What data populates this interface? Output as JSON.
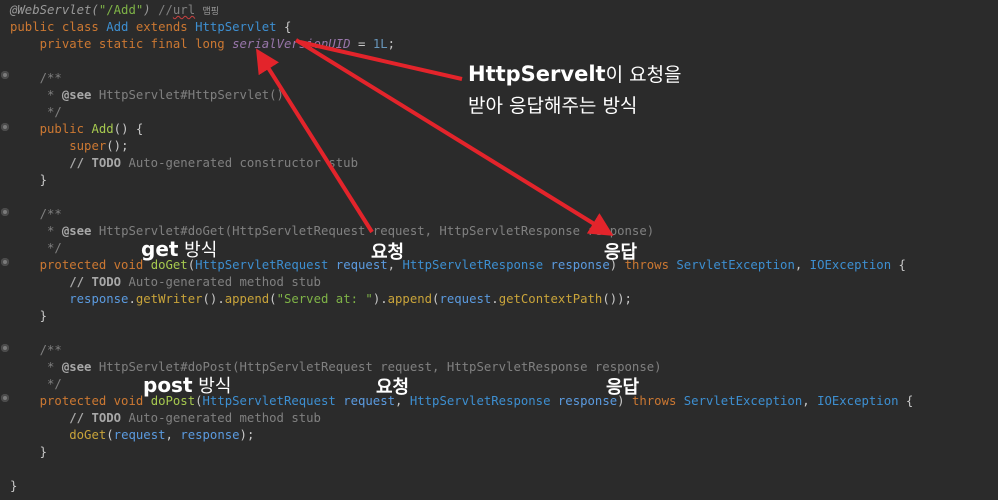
{
  "code": {
    "l1_ann": "@WebServlet(",
    "l1_str": "\"/Add\"",
    "l1_close": ")",
    "l1_cm": " //",
    "l1_url": "url",
    "l1_map": "맵핑",
    "l2_kw": "public class",
    "l2_cls": "Add",
    "l2_ext": "extends",
    "l2_sup": "HttpServlet",
    "l2_brace": " {",
    "l3_kw": "private static final long",
    "l3_fld": "serialVersionUID",
    "l3_eq": " = ",
    "l3_num": "1L",
    "l3_semi": ";",
    "l5": "/**",
    "l6_star": " * ",
    "l6_tag": "@see",
    "l6_rest": " HttpServlet#HttpServlet()",
    "l7": " */",
    "l8_kw": "public",
    "l8_name": "Add",
    "l8_rest": "() {",
    "l9_super": "super",
    "l9_rest": "();",
    "l10_todo": "// TODO",
    "l10_rest": " Auto-generated constructor stub",
    "l11": "}",
    "l13": "/**",
    "l14_star": " * ",
    "l14_tag": "@see",
    "l14_rest": " HttpServlet#doGet(HttpServletRequest request, HttpServletResponse response)",
    "l15": " */",
    "l16_kw": "protected void",
    "l16_name": "doGet",
    "l16_p1": "(",
    "l16_t1": "HttpServletRequest",
    "l16_v1": "request",
    "l16_c": ", ",
    "l16_t2": "HttpServletResponse",
    "l16_v2": "response",
    "l16_p2": ")",
    "l16_throws": "throws",
    "l16_e1": "ServletException",
    "l16_e2": "IOException",
    "l16_b": " {",
    "l17_todo": "// TODO",
    "l17_rest": " Auto-generated method stub",
    "l18_resp": "response",
    "l18_dot": ".",
    "l18_gw": "getWriter",
    "l18_a": "().",
    "l18_app": "append",
    "l18_p": "(",
    "l18_str": "\"Served at: \"",
    "l18_b": ").",
    "l18_app2": "append",
    "l18_p2": "(",
    "l18_req": "request",
    "l18_d2": ".",
    "l18_gcp": "getContextPath",
    "l18_end": "());",
    "l19": "}",
    "l21": "/**",
    "l22_star": " * ",
    "l22_tag": "@see",
    "l22_rest": " HttpServlet#doPost(HttpServletRequest request, HttpServletResponse response)",
    "l23": " */",
    "l24_kw": "protected void",
    "l24_name": "doPost",
    "l24_p1": "(",
    "l24_t1": "HttpServletRequest",
    "l24_v1": "request",
    "l24_c": ", ",
    "l24_t2": "HttpServletResponse",
    "l24_v2": "response",
    "l24_p2": ")",
    "l24_throws": "throws",
    "l24_e1": "ServletException",
    "l24_e2": "IOException",
    "l24_b": " {",
    "l25_todo": "// TODO",
    "l25_rest": " Auto-generated method stub",
    "l26_call": "doGet",
    "l26_p": "(",
    "l26_req": "request",
    "l26_c": ", ",
    "l26_resp": "response",
    "l26_end": ");",
    "l27": "}",
    "l29": "}"
  },
  "annotations": {
    "note_bold": "HttpServelt",
    "note_rest1": "이 요청을",
    "note_line2": "받아 응답해주는 방식",
    "get_bold": "get",
    "get_rest": " 방식",
    "req1": "요청",
    "resp1": "응답",
    "post_bold": "post",
    "post_rest": " 방식",
    "req2": "요청",
    "resp2": "응답"
  },
  "colors": {
    "background": "#2b2b2b",
    "arrow": "#e3242b"
  }
}
